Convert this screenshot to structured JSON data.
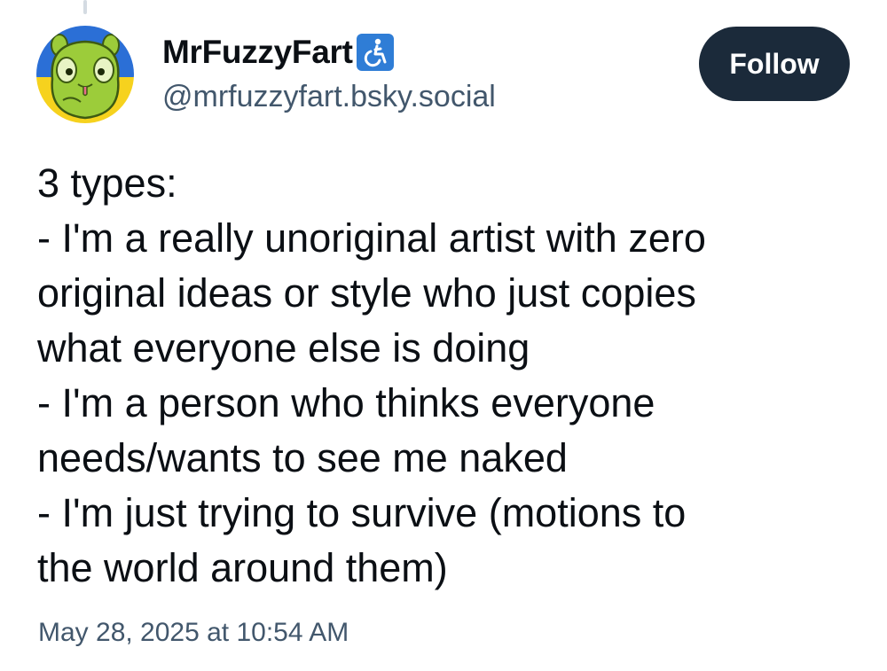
{
  "post": {
    "author": {
      "display_name": "MrFuzzyFart",
      "name_emoji": "wheelchair-symbol-icon",
      "handle": "@mrfuzzyfart.bsky.social",
      "avatar": "green-creature-avatar-on-ukraine-flag"
    },
    "follow_label": "Follow",
    "text_lines": [
      "3 types:",
      "- I'm a really unoriginal artist with zero",
      "original ideas or style who just copies",
      "what everyone else is doing",
      "- I'm a person who thinks everyone",
      "needs/wants to see me naked",
      "- I'm just trying to survive (motions to",
      "the world around them)"
    ],
    "timestamp": "May 28, 2025 at 10:54 AM"
  },
  "colors": {
    "follow_button_bg": "#1b2a3a",
    "secondary_text": "#42576c",
    "primary_text": "#0b0f14",
    "avatar_flag_blue": "#2b6fd6",
    "avatar_flag_yellow": "#f6d21e",
    "avatar_creature_green": "#9ccc3a"
  }
}
